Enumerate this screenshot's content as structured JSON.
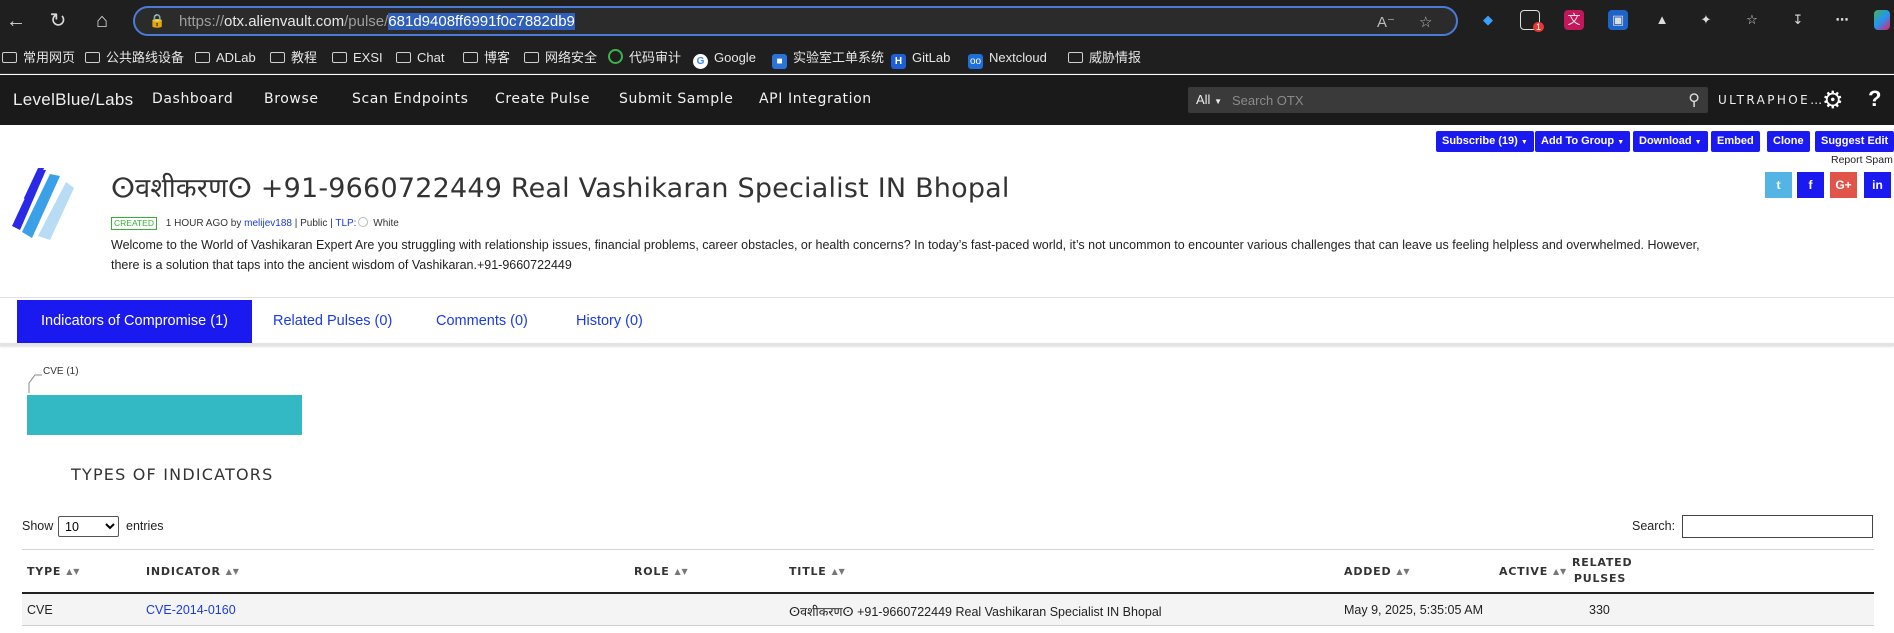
{
  "browser": {
    "url_scheme": "https://",
    "url_host": "otx.alienvault.com",
    "url_path": "/pulse/",
    "url_selected": "681d9408ff6991f0c7882db9",
    "bookmarks": [
      "常用网页",
      "公共路线设备",
      "ADLab",
      "教程",
      "EXSI",
      "Chat",
      "博客",
      "网络安全",
      "代码审计",
      "Google",
      "实验室工单系统",
      "GitLab",
      "Nextcloud",
      "威胁情报"
    ],
    "ext_badge": "1"
  },
  "site": {
    "logo": "LevelBlue/Labs",
    "menu": [
      "Dashboard",
      "Browse",
      "Scan Endpoints",
      "Create Pulse",
      "Submit Sample",
      "API Integration"
    ],
    "search_scope": "All",
    "search_placeholder": "Search OTX",
    "user": "ULTRAPHOE…",
    "help": "?"
  },
  "actions": {
    "subscribe": "Subscribe (19)",
    "add_to_group": "Add To Group",
    "download": "Download",
    "embed": "Embed",
    "clone": "Clone",
    "suggest_edit": "Suggest Edit",
    "report_spam": "Report Spam",
    "social": [
      "t",
      "f",
      "G+",
      "in"
    ]
  },
  "pulse": {
    "title": "ⵙवशीकरणⵙ +91-9660722449 Real Vashikaran Specialist IN Bhopal",
    "created_badge": "CREATED",
    "created_time": "1 HOUR AGO by",
    "author": "melijev188",
    "visibility": "| Public |",
    "tlp_label": "TLP:",
    "tlp_value": "White",
    "description": "Welcome to the World of Vashikaran Expert Are you struggling with relationship issues, financial problems, career obstacles, or health concerns? In today’s fast-paced world, it’s not uncommon to encounter various challenges that can leave us feeling helpless and overwhelmed. However, there is a solution that taps into the ancient wisdom of Vashikaran.+91-9660722449"
  },
  "tabs": [
    "Indicators of Compromise (1)",
    "Related Pulses (0)",
    "Comments (0)",
    "History (0)"
  ],
  "chart_data": {
    "type": "bar",
    "categories": [
      "CVE (1)"
    ],
    "values": [
      1
    ],
    "color": "#33b9c3"
  },
  "indicators_heading": "TYPES OF INDICATORS",
  "table_controls": {
    "show": "Show",
    "entries_value": "10",
    "entries_options": [
      "10"
    ],
    "entries": "entries",
    "search": "Search:"
  },
  "table": {
    "headers": [
      "TYPE",
      "INDICATOR",
      "ROLE",
      "TITLE",
      "ADDED",
      "ACTIVE"
    ],
    "header_related": [
      "RELATED",
      "PULSES"
    ],
    "rows": [
      {
        "type": "CVE",
        "indicator": "CVE-2014-0160",
        "role": "",
        "title": "ⵙवशीकरणⵙ +91-9660722449 Real Vashikaran Specialist IN Bhopal",
        "added": "May 9, 2025, 5:35:05 AM",
        "active": "",
        "related_pulses": "330"
      }
    ]
  },
  "colors": {
    "accent": "#1a1af0",
    "link": "#1a3be0",
    "header_bg": "#1a1a1a",
    "chrome_bg": "#1f1f1f",
    "bar": "#33b9c3"
  }
}
